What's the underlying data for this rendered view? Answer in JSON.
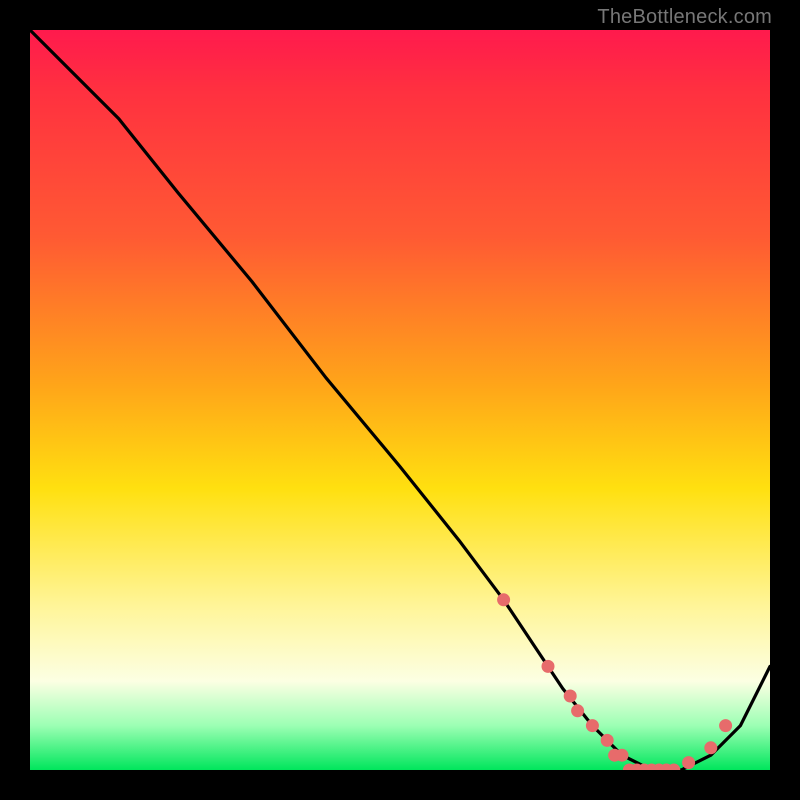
{
  "watermark": "TheBottleneck.com",
  "chart_data": {
    "type": "line",
    "title": "",
    "xlabel": "",
    "ylabel": "",
    "xlim": [
      0,
      100
    ],
    "ylim": [
      0,
      100
    ],
    "grid": false,
    "background": "vertical-gradient red→orange→yellow→green",
    "series": [
      {
        "name": "curve",
        "x": [
          0,
          6,
          12,
          20,
          30,
          40,
          50,
          58,
          64,
          68,
          72,
          76,
          80,
          84,
          88,
          92,
          96,
          100
        ],
        "y": [
          100,
          94,
          88,
          78,
          66,
          53,
          41,
          31,
          23,
          17,
          11,
          6,
          2,
          0,
          0,
          2,
          6,
          14
        ],
        "markers_x": [
          64,
          70,
          73,
          74,
          76,
          78,
          79,
          80,
          81,
          82,
          83,
          84,
          85,
          86,
          87,
          89,
          92,
          94
        ],
        "markers_y": [
          23,
          14,
          10,
          8,
          6,
          4,
          2,
          2,
          0,
          0,
          0,
          0,
          0,
          0,
          0,
          1,
          3,
          6
        ]
      }
    ],
    "colors": {
      "line": "#000000",
      "marker": "#e76b6b",
      "frame": "#000000"
    }
  }
}
